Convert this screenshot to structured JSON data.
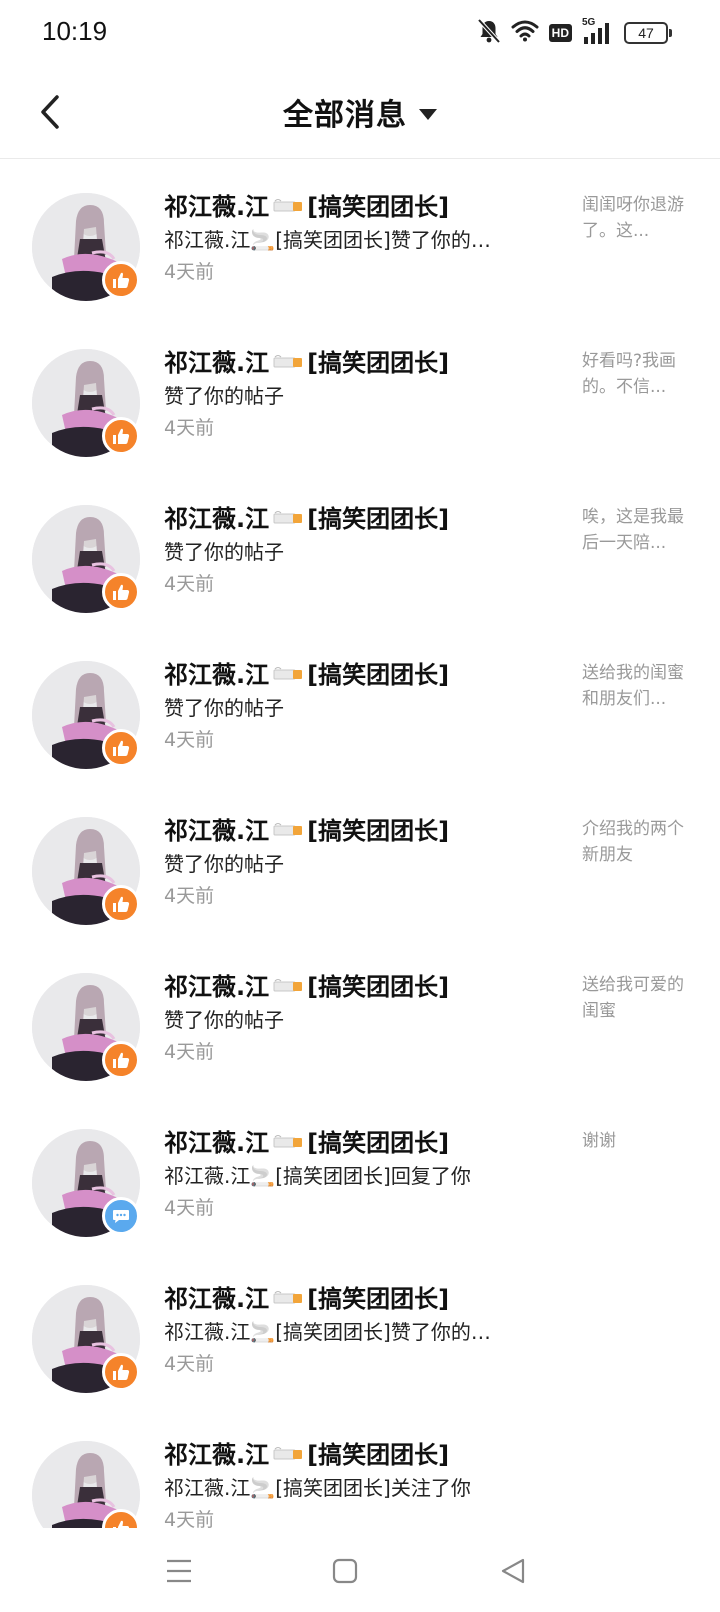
{
  "status_bar": {
    "time": "10:19",
    "network": "5G",
    "hd": "HD",
    "battery": "47"
  },
  "header": {
    "title": "全部消息"
  },
  "colors": {
    "like_badge": "#f5832a",
    "comment_badge": "#5aa9ee",
    "time_text": "#999999"
  },
  "messages": [
    {
      "name_pre": "祁江薇.江",
      "name_post": "[搞笑团团长]",
      "action": "祁江薇.江🚬[搞笑团团长]赞了你的…",
      "time": "4天前",
      "preview": "闺闺呀你退游了。这...",
      "badge": "thumbs-up-icon"
    },
    {
      "name_pre": "祁江薇.江",
      "name_post": "[搞笑团团长]",
      "action": "赞了你的帖子",
      "time": "4天前",
      "preview": "好看吗?我画的。不信...",
      "badge": "thumbs-up-icon"
    },
    {
      "name_pre": "祁江薇.江",
      "name_post": "[搞笑团团长]",
      "action": "赞了你的帖子",
      "time": "4天前",
      "preview": "唉，这是我最后一天陪...",
      "badge": "thumbs-up-icon"
    },
    {
      "name_pre": "祁江薇.江",
      "name_post": "[搞笑团团长]",
      "action": "赞了你的帖子",
      "time": "4天前",
      "preview": "送给我的闺蜜和朋友们...",
      "badge": "thumbs-up-icon"
    },
    {
      "name_pre": "祁江薇.江",
      "name_post": "[搞笑团团长]",
      "action": "赞了你的帖子",
      "time": "4天前",
      "preview": "介绍我的两个新朋友",
      "badge": "thumbs-up-icon"
    },
    {
      "name_pre": "祁江薇.江",
      "name_post": "[搞笑团团长]",
      "action": "赞了你的帖子",
      "time": "4天前",
      "preview": "送给我可爱的闺蜜",
      "badge": "thumbs-up-icon"
    },
    {
      "name_pre": "祁江薇.江",
      "name_post": "[搞笑团团长]",
      "action": "祁江薇.江🚬[搞笑团团长]回复了你",
      "time": "4天前",
      "preview": "谢谢",
      "badge": "comment-icon"
    },
    {
      "name_pre": "祁江薇.江",
      "name_post": "[搞笑团团长]",
      "action": "祁江薇.江🚬[搞笑团团长]赞了你的…",
      "time": "4天前",
      "preview": "",
      "badge": "thumbs-up-icon"
    },
    {
      "name_pre": "祁江薇.江",
      "name_post": "[搞笑团团长]",
      "action": "祁江薇.江🚬[搞笑团团长]关注了你",
      "time": "4天前",
      "preview": "",
      "badge": "thumbs-up-icon"
    }
  ]
}
